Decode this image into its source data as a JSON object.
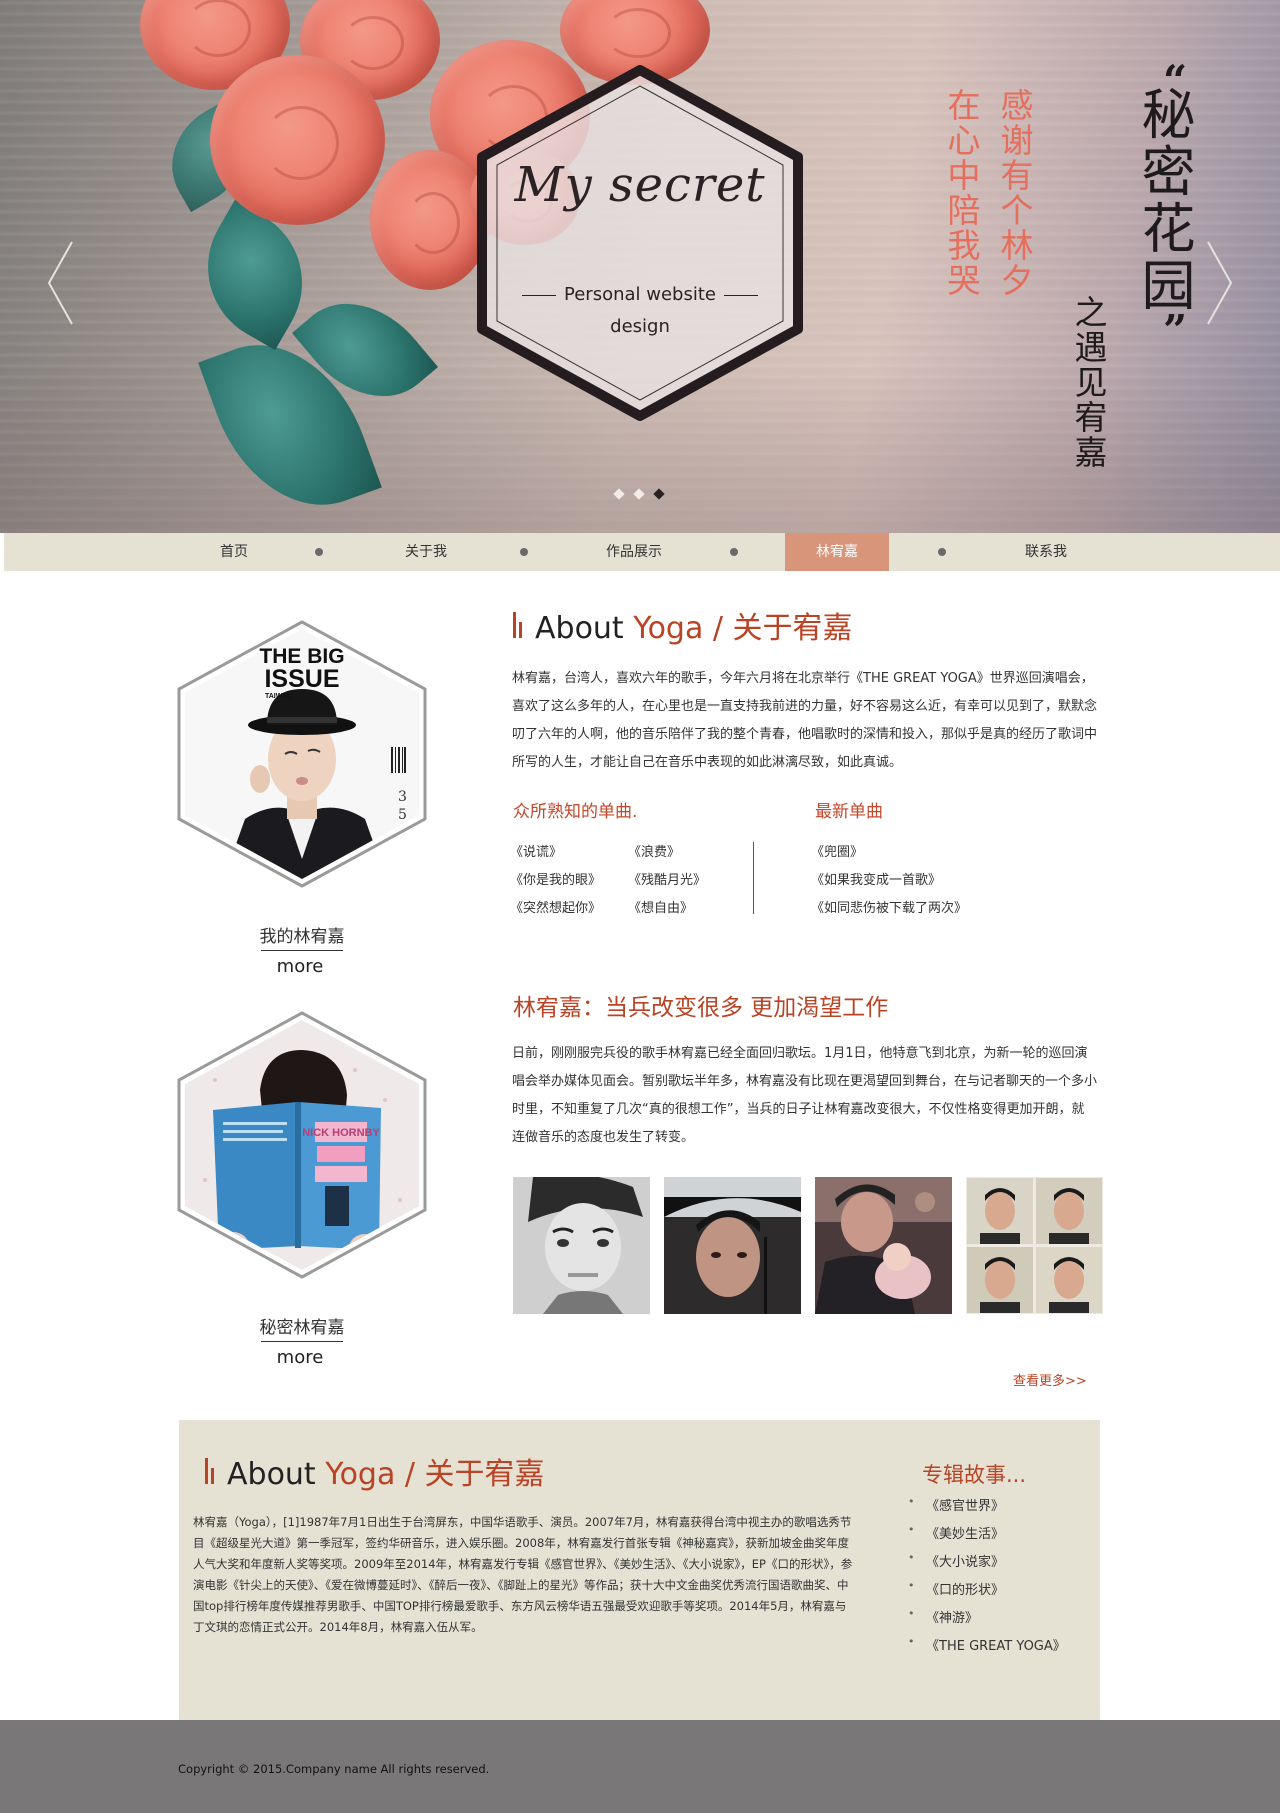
{
  "hero": {
    "logo_script": "My secret",
    "logo_sub1": "Personal website",
    "logo_sub2": "design",
    "vertical_pink_1": "感谢有个林夕",
    "vertical_pink_2": "在心中陪我哭",
    "vertical_big": "秘密花园",
    "vertical_mid": "之遇见宥嘉",
    "slide_count": 3,
    "active_slide": 3,
    "prev_icon": "chevron-left-icon",
    "next_icon": "chevron-right-icon"
  },
  "nav": {
    "items": [
      {
        "label": "首页"
      },
      {
        "label": "关于我"
      },
      {
        "label": "作品展示"
      },
      {
        "label": "林宥嘉"
      },
      {
        "label": "联系我"
      }
    ],
    "active_index": 3,
    "active_color": "#d9957a"
  },
  "left": {
    "card1": {
      "cover_title1": "THE BIG",
      "cover_title2": "ISSUE",
      "cover_sub": "TAIWAN",
      "cover_num1": "3",
      "cover_num2": "5",
      "caption": "我的林宥嘉",
      "more": "more"
    },
    "card2": {
      "book_title": "NICK HORNBY",
      "caption": "秘密林宥嘉",
      "more": "more"
    }
  },
  "about": {
    "title_en": "About ",
    "title_accent": "Yoga / 关于宥嘉",
    "paragraph": "林宥嘉，台湾人，喜欢六年的歌手，今年六月将在北京举行《THE GREAT YOGA》世界巡回演唱会，喜欢了这么多年的人，在心里也是一直支持我前进的力量，好不容易这么近，有幸可以见到了，默默念叨了六年的人啊，他的音乐陪伴了我的整个青春，他唱歌时的深情和投入，那似乎是真的经历了歌词中所写的人生，才能让自己在音乐中表现的如此淋漓尽致，如此真诚。",
    "famous_heading": "众所熟知的单曲.",
    "famous_songs_col1": [
      "《说谎》",
      "《你是我的眼》",
      "《突然想起你》"
    ],
    "famous_songs_col2": [
      "《浪费》",
      "《残酷月光》",
      "《想自由》"
    ],
    "latest_heading": "最新单曲",
    "latest_songs": [
      "《兜圈》",
      "《如果我变成一首歌》",
      "《如同悲伤被下载了两次》"
    ]
  },
  "news": {
    "title": "林宥嘉：当兵改变很多 更加渴望工作",
    "paragraph": "日前，刚刚服完兵役的歌手林宥嘉已经全面回归歌坛。1月1日，他特意飞到北京，为新一轮的巡回演唱会举办媒体见面会。暂别歌坛半年多，林宥嘉没有比现在更渴望回到舞台，在与记者聊天的一个多小时里，不知重复了几次“真的很想工作”，当兵的日子让林宥嘉改变很大，不仅性格变得更加开朗，就连做音乐的态度也发生了转变。",
    "see_more": "查看更多>>"
  },
  "lower": {
    "title_en": "About ",
    "title_accent": "Yoga / 关于宥嘉",
    "paragraph": "林宥嘉（Yoga），[1]1987年7月1日出生于台湾屏东，中国华语歌手、演员。2007年7月，林宥嘉获得台湾中视主办的歌唱选秀节目《超级星光大道》第一季冠军，签约华研音乐，进入娱乐圈。2008年，林宥嘉发行首张专辑《神秘嘉宾》，获新加坡金曲奖年度人气大奖和年度新人奖等奖项。2009年至2014年，林宥嘉发行专辑《感官世界》、《美妙生活》、《大小说家》，EP《口的形状》，参演电影《针尖上的天使》、《爱在微博蔓延时》、《醉后一夜》、《脚趾上的星光》等作品；获十大中文金曲奖优秀流行国语歌曲奖、中国top排行榜年度传媒推荐男歌手、中国TOP排行榜最爱歌手、东方风云榜华语五强最受欢迎歌手等奖项。2014年5月，林宥嘉与丁文琪的恋情正式公开。2014年8月，林宥嘉入伍从军。",
    "story_heading": "专辑故事...",
    "stories": [
      "《感官世界》",
      "《美妙生活》",
      "《大小说家》",
      "《口的形状》",
      "《神游》",
      "《THE GREAT YOGA》"
    ]
  },
  "footer": {
    "copyright": "Copyright © 2015.Company name All rights reserved."
  },
  "colors": {
    "accent": "#b84325",
    "beige": "#e5e2d4",
    "footer_bg": "#7a7778"
  }
}
